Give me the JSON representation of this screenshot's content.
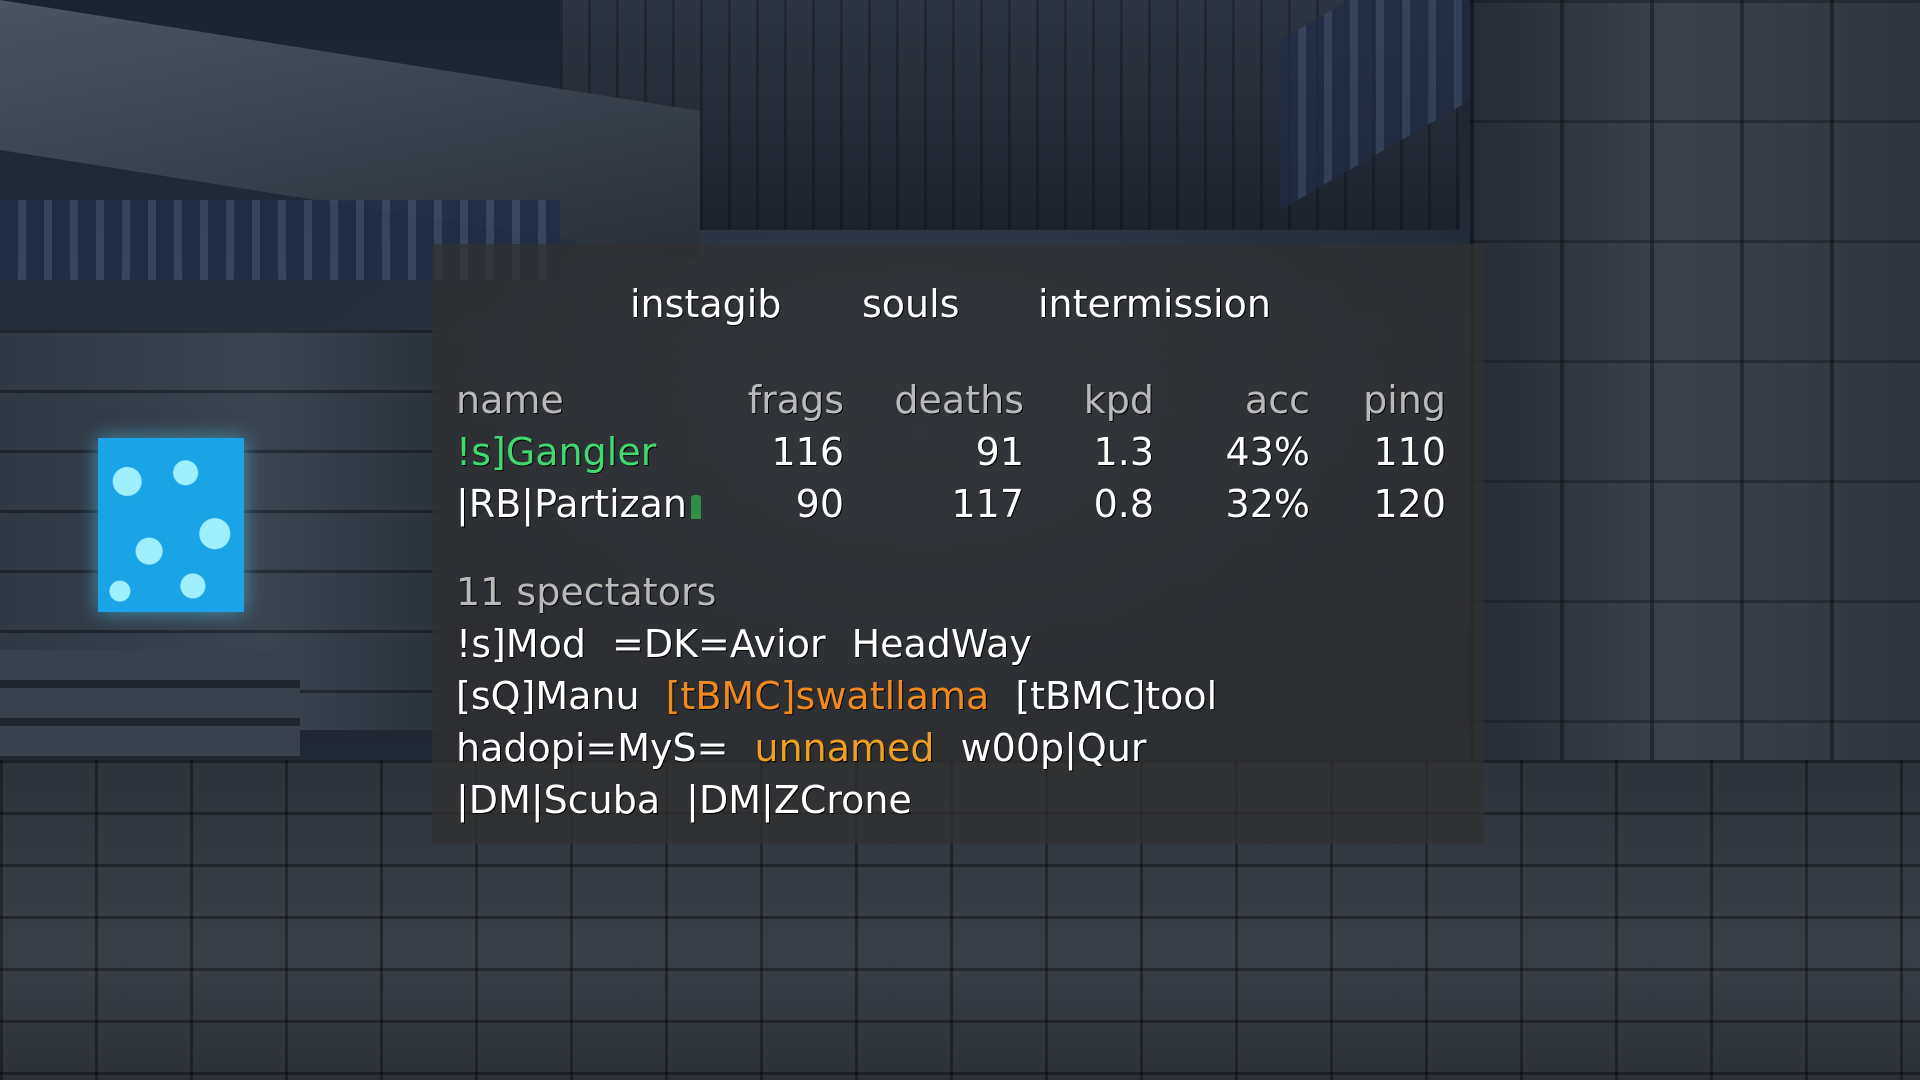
{
  "header": {
    "mode": "instagib",
    "map": "souls",
    "status": "intermission"
  },
  "scoreboard": {
    "columns": [
      "name",
      "frags",
      "deaths",
      "kpd",
      "acc",
      "ping"
    ],
    "players": [
      {
        "name": "!s]Gangler",
        "frags": "116",
        "deaths": "91",
        "kpd": "1.3",
        "acc": "43%",
        "ping": "110"
      },
      {
        "name": "|RB|Partizan",
        "frags": "90",
        "deaths": "117",
        "kpd": "0.8",
        "acc": "32%",
        "ping": "120"
      }
    ]
  },
  "spectators": {
    "title": "11 spectators",
    "rows": [
      [
        "!s]Mod",
        "=DK=Avior",
        "HeadWay"
      ],
      [
        "[sQ]Manu",
        "[tBMC]swatllama",
        "[tBMC]tool"
      ],
      [
        "hadopi=MyS=",
        "unnamed",
        "w00p|Qur"
      ],
      [
        "|DM|Scuba",
        "|DM|ZCrone"
      ]
    ]
  },
  "colors": {
    "player_name": "#41d870",
    "highlight_orange": "#f08a20",
    "highlight_amber": "#f0a020",
    "header_text": "#b9b9b9"
  },
  "icons": {
    "player_weapon": "weapon-icon"
  }
}
